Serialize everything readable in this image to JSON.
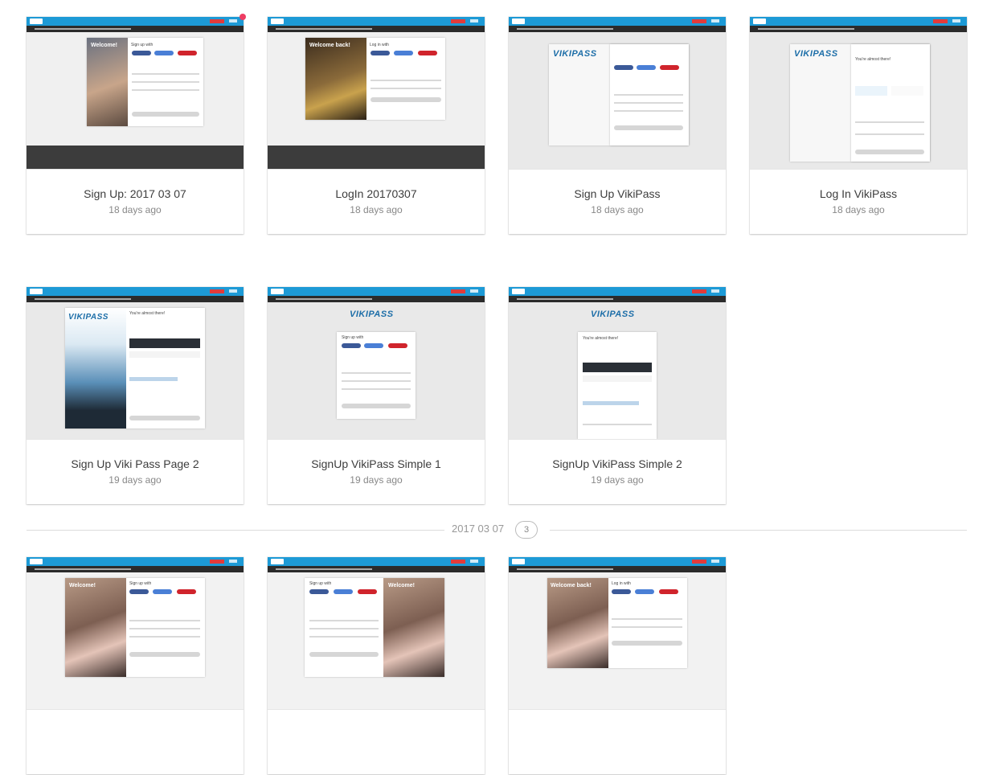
{
  "cards": [
    {
      "title": "Sign Up: 2017 03 07",
      "time": "18 days ago"
    },
    {
      "title": "LogIn 20170307",
      "time": "18 days ago"
    },
    {
      "title": "Sign Up VikiPass",
      "time": "18 days ago"
    },
    {
      "title": "Log In VikiPass",
      "time": "18 days ago"
    },
    {
      "title": "Sign Up Viki Pass Page 2",
      "time": "19 days ago"
    },
    {
      "title": "SignUp VikiPass Simple 1",
      "time": "19 days ago"
    },
    {
      "title": "SignUp VikiPass Simple 2",
      "time": "19 days ago"
    },
    {
      "title": "",
      "time": ""
    },
    {
      "title": "",
      "time": ""
    },
    {
      "title": "",
      "time": ""
    }
  ],
  "thumb_text": {
    "welcome": "Welcome!",
    "welcome_back": "Welcome back!",
    "sign_up_with": "Sign up with",
    "log_in_with": "Log in with",
    "vikipass": "VIKIPASS",
    "almost_there": "You're almost there!"
  },
  "group": {
    "label": "2017 03 07",
    "count": "3"
  },
  "colors": {
    "viki_blue": "#1d9ad6",
    "notify": "#ee3d63"
  }
}
